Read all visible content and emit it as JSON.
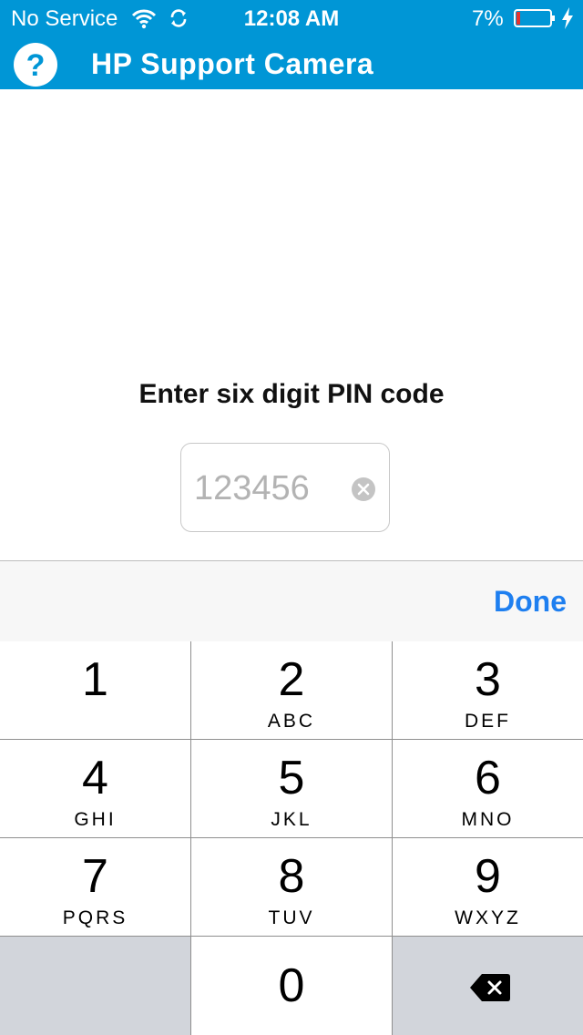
{
  "status_bar": {
    "carrier": "No Service",
    "time": "12:08 AM",
    "battery_percent": "7%",
    "icons": [
      "wifi-icon",
      "sync-icon",
      "battery-icon",
      "charging-bolt-icon"
    ]
  },
  "nav": {
    "title": "HP Support Camera",
    "help_icon": "help-question-icon"
  },
  "prompt": "Enter six digit PIN code",
  "pin_input": {
    "value": "",
    "placeholder": "123456",
    "clear_icon": "clear-x-icon"
  },
  "keyboard": {
    "done_label": "Done",
    "keys": [
      {
        "num": "1",
        "letters": ""
      },
      {
        "num": "2",
        "letters": "ABC"
      },
      {
        "num": "3",
        "letters": "DEF"
      },
      {
        "num": "4",
        "letters": "GHI"
      },
      {
        "num": "5",
        "letters": "JKL"
      },
      {
        "num": "6",
        "letters": "MNO"
      },
      {
        "num": "7",
        "letters": "PQRS"
      },
      {
        "num": "8",
        "letters": "TUV"
      },
      {
        "num": "9",
        "letters": "WXYZ"
      },
      {
        "num": "0",
        "letters": ""
      }
    ],
    "delete_icon": "backspace-icon"
  },
  "colors": {
    "brand_blue": "#0096d6",
    "done_blue": "#1e7ff0",
    "battery_low_red": "#e8322e"
  }
}
